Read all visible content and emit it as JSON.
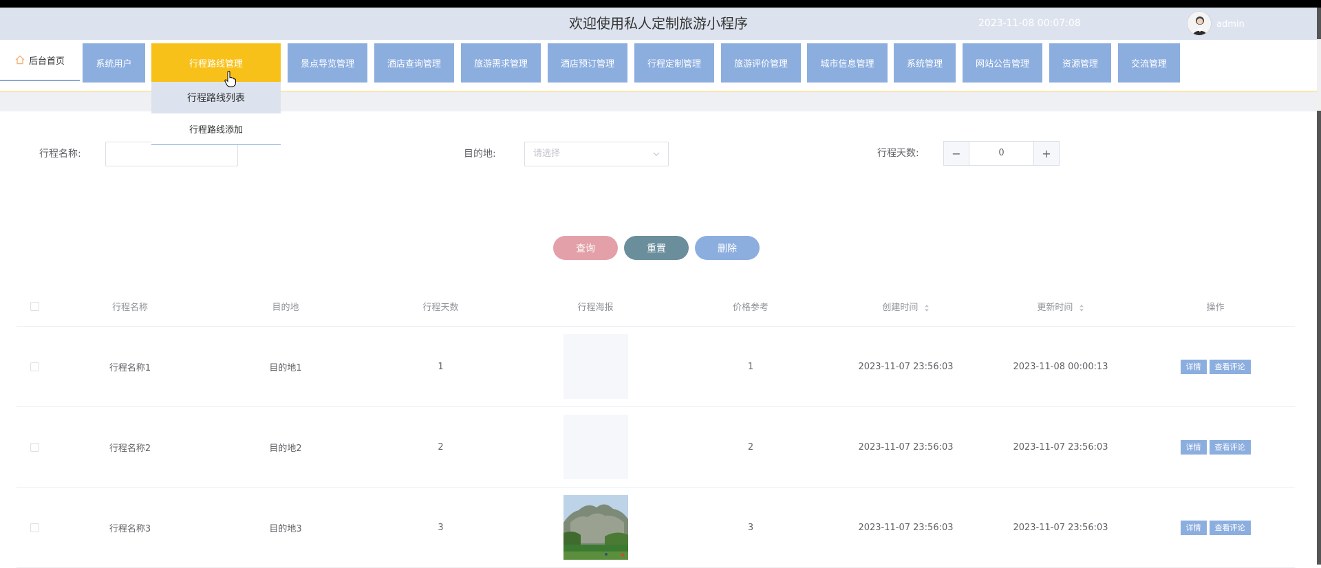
{
  "header": {
    "title": "欢迎使用私人定制旅游小程序",
    "datetime": "2023-11-08 00:07:08",
    "username": "admin"
  },
  "nav": {
    "home": "后台首页",
    "items": [
      {
        "label": "系统用户"
      },
      {
        "label": "行程路线管理",
        "active": true
      },
      {
        "label": "景点导览管理"
      },
      {
        "label": "酒店查询管理"
      },
      {
        "label": "旅游需求管理"
      },
      {
        "label": "酒店预订管理"
      },
      {
        "label": "行程定制管理"
      },
      {
        "label": "旅游评价管理"
      },
      {
        "label": "城市信息管理"
      },
      {
        "label": "系统管理"
      },
      {
        "label": "网站公告管理"
      },
      {
        "label": "资源管理"
      },
      {
        "label": "交流管理"
      }
    ],
    "dropdown": [
      "行程路线列表",
      "行程路线添加"
    ]
  },
  "search": {
    "name_label": "行程名称:",
    "name_value": "",
    "dest_label": "目的地:",
    "dest_placeholder": "请选择",
    "days_label": "行程天数:",
    "days_value": "0",
    "minus": "−",
    "plus": "+"
  },
  "buttons": {
    "query": "查询",
    "reset": "重置",
    "delete": "删除"
  },
  "table": {
    "headers": [
      "行程名称",
      "目的地",
      "行程天数",
      "行程海报",
      "价格参考",
      "创建时间",
      "更新时间",
      "操作"
    ],
    "rows": [
      {
        "name": "行程名称1",
        "dest": "目的地1",
        "days": "1",
        "price": "1",
        "created": "2023-11-07 23:56:03",
        "updated": "2023-11-08 00:00:13",
        "poster": "blank"
      },
      {
        "name": "行程名称2",
        "dest": "目的地2",
        "days": "2",
        "price": "2",
        "created": "2023-11-07 23:56:03",
        "updated": "2023-11-07 23:56:03",
        "poster": "blank"
      },
      {
        "name": "行程名称3",
        "dest": "目的地3",
        "days": "3",
        "price": "3",
        "created": "2023-11-07 23:56:03",
        "updated": "2023-11-07 23:56:03",
        "poster": "photo"
      }
    ],
    "op_detail": "详情",
    "op_comment": "查看评论"
  },
  "colors": {
    "nav_item": "#8caedf",
    "nav_active": "#f8c11a",
    "query_btn": "#e3a0a8",
    "reset_btn": "#6a8e9b",
    "delete_btn": "#8caedf"
  }
}
